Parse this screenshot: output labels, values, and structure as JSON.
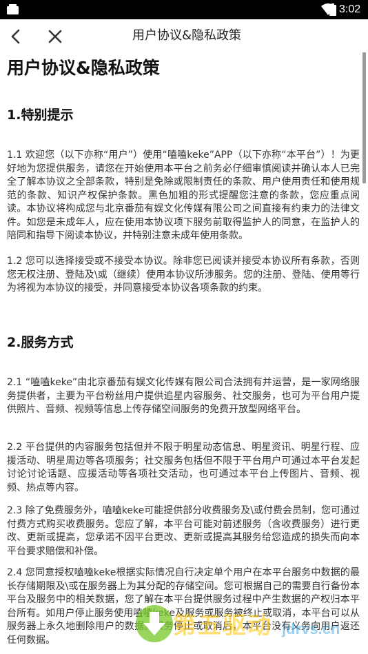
{
  "status_bar": {
    "time": "3:02"
  },
  "nav": {
    "title": "用户协议&隐私政策"
  },
  "doc": {
    "title": "用户协议&隐私政策",
    "sections": [
      {
        "heading": "1.特别提示"
      },
      {
        "heading": "2.服务方式"
      }
    ],
    "paragraphs": {
      "p1_1": "1.1 欢迎您（以下亦称“用户”）使用“嗑嗑keke”APP（以下亦称“本平台”）！为更好地为您提供服务，请您在开始使用本平台之前务必仔细审慎阅读并确认本人已完全了解本协议之全部条款，特别是免除或限制责任的条款、用户使用责任和使用规范的条款、知识产权保护条款。黑色加粗的形式提醒您注意的条款，您应重点阅读。本协议将构成您与北京番茄有娱文化传媒有限公司之间直接有约束力的法律文件。如您是未成年人，应在使用本协议项下服务前取得监护人的同意，在监护人的陪同和指导下阅读本协议，并特别注意未成年使用条款。",
      "p1_2": "1.2 您可以选择接受或不接受本协议。除非您已阅读并接受本协议所有条款，否则您无权注册、登陆及\\或（继续）使用本协议所涉服务。您的注册、登陆、使用等行为将视为本协议的接受，并同意接受本协议各项条款的约束。",
      "p2_1": "2.1 “嗑嗑keke”由北京番茄有娱文化传媒有限公司合法拥有并运营，是一家网络服务提供者，主要为平台粉丝用户提供追星内容服务、社交服务，也可为平台用户提供照片、音频、视频等信息上传存储空间服务的免费开放型网络平台。",
      "p2_2": "2.2 平台提供的内容服务包括但并不限于明星动态信息、明星资讯、明星行程、应援活动、明星周边等各项服务；社交服务包括但不限于平台用户可通过本平台发起讨论讨论话题、应援活动等各项社交活动，也可通过本平台上传图片、音频、视频、热点等内容。",
      "p2_3": "2.3 除了免费服务外，嗑嗑keke可能提供部分收费服务及\\或付费会员制，您可通过付费方式购买收费服务。您应了解，本平台可能对前述服务（含收费服务）进行更改、更新或提高，您承诺不因平台更改、更新或提高其服务给您造成的损失而向本平台要求赔偿和补偿。",
      "p2_4": "2.4 您同意授权嗑嗑keke根据实际情况自行决定单个用户在本平台服务中数据的最长存储期限及\\或在服务器上为其分配的存储空间。您可根据自己的需要自行备份本平台及服务中的相关数据，您了解在本平台提供服务过程中产生数据的产权归本平台所有。如用户停止服务使用嗑嗑keke及服务或服务被终止或取消，本平台可以从服务器上永久地删除用户的数据。服务停止或取消后，本平台没有义务向用户返还任何数据。"
    }
  },
  "watermark": {
    "text": "第五驱动",
    "url": "jdrvs.cn"
  },
  "colors": {
    "status_bar": "#000000",
    "background": "#ffffff",
    "text": "#333333"
  }
}
